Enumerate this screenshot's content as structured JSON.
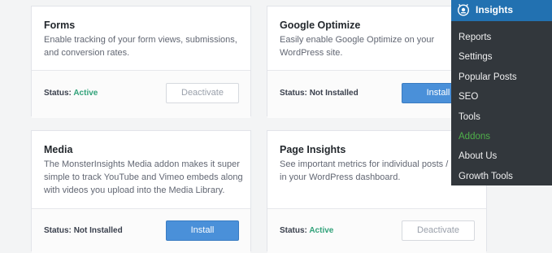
{
  "addons": [
    {
      "title": "Forms",
      "description": "Enable tracking of your form views, submissions, and conversion rates.",
      "status_label": "Status:",
      "status_value": "Active",
      "button_label": "Deactivate"
    },
    {
      "title": "Google Optimize",
      "description": "Easily enable Google Optimize on your WordPress site.",
      "status_label": "Status:",
      "status_value": "Not Installed",
      "button_label": "Install"
    },
    {
      "title": "Media",
      "description": "The MonsterInsights Media addon makes it super simple to track YouTube and Vimeo embeds along with videos you upload into the Media Library.",
      "status_label": "Status:",
      "status_value": "Not Installed",
      "button_label": "Install"
    },
    {
      "title": "Page Insights",
      "description": "See important metrics for individual posts / pa in your WordPress dashboard.",
      "status_label": "Status:",
      "status_value": "Active",
      "button_label": "Deactivate"
    }
  ],
  "menu": {
    "title": "Insights",
    "logo_icon": "monsterinsights-logo-icon",
    "items": [
      "Reports",
      "Settings",
      "Popular Posts",
      "SEO",
      "Tools",
      "Addons",
      "About Us",
      "Growth Tools"
    ],
    "current": "Addons"
  },
  "colors": {
    "active": "#32a27a",
    "install_button": "#4a90d9",
    "menu_bg": "#32373c",
    "menu_header": "#2271b1",
    "menu_current": "#4fb04a"
  }
}
